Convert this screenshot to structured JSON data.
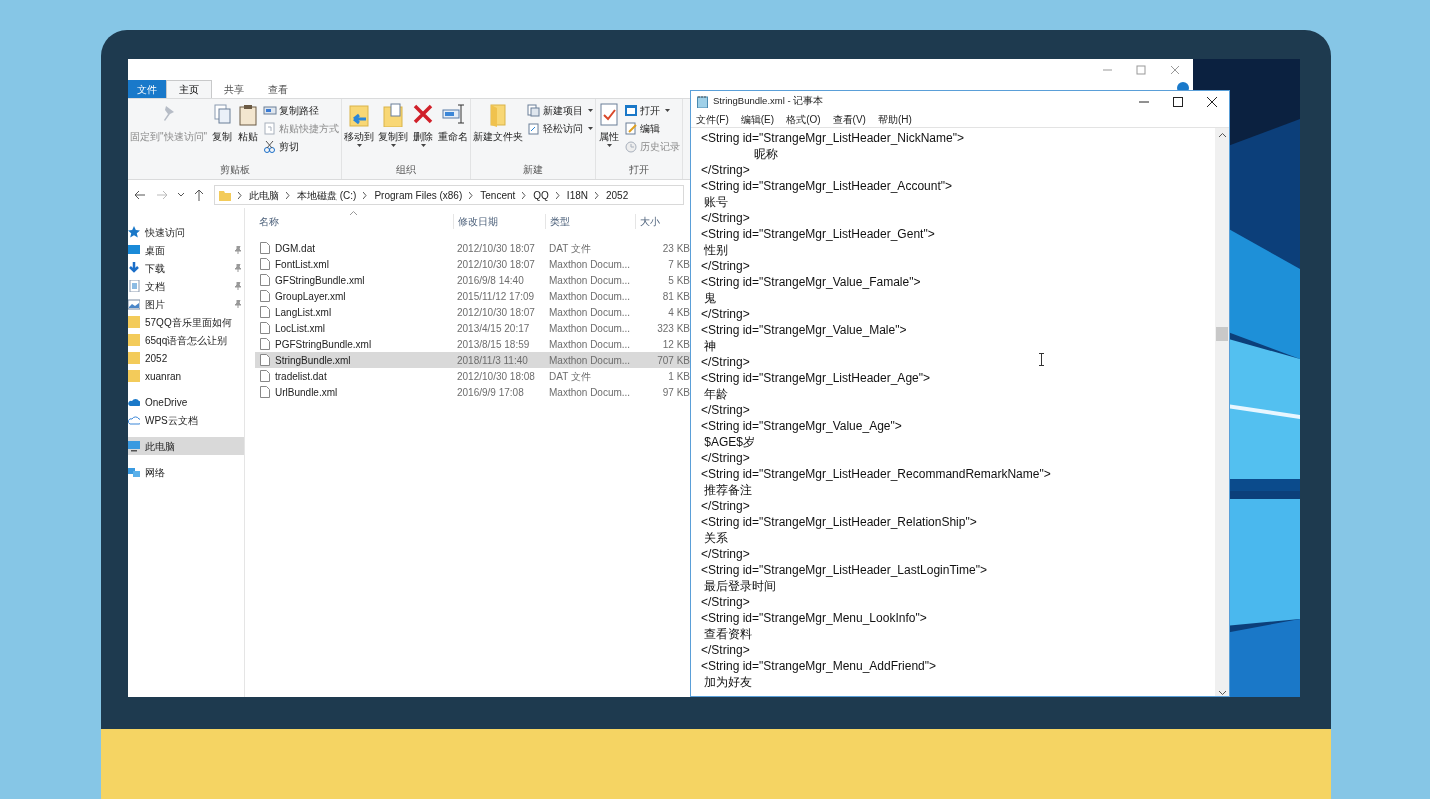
{
  "explorer": {
    "tabs": [
      {
        "label": "文件",
        "selected": false,
        "kind": "file"
      },
      {
        "label": "主页",
        "selected": true,
        "kind": "tab"
      },
      {
        "label": "共享",
        "selected": false,
        "kind": "tab"
      },
      {
        "label": "查看",
        "selected": false,
        "kind": "tab"
      }
    ],
    "ribbon_groups": [
      {
        "label": "剪贴板",
        "items": [
          {
            "kind": "large",
            "label": "固定到\"快速访问\"",
            "disabled": true,
            "dropdown": false
          },
          {
            "kind": "large",
            "label": "复制",
            "disabled": false,
            "dropdown": false
          },
          {
            "kind": "large",
            "label": "粘贴",
            "disabled": false,
            "dropdown": false
          },
          {
            "kind": "small",
            "label": "复制路径",
            "disabled": false,
            "dropdown": false
          },
          {
            "kind": "small",
            "label": "粘贴快捷方式",
            "disabled": true,
            "dropdown": false
          },
          {
            "kind": "small",
            "label": "剪切",
            "disabled": false,
            "dropdown": false
          }
        ]
      },
      {
        "label": "组织",
        "items": [
          {
            "kind": "large",
            "label": "移动到",
            "disabled": false,
            "dropdown": true
          },
          {
            "kind": "large",
            "label": "复制到",
            "disabled": false,
            "dropdown": true
          },
          {
            "kind": "large",
            "label": "删除",
            "disabled": false,
            "dropdown": true
          },
          {
            "kind": "large",
            "label": "重命名",
            "disabled": false,
            "dropdown": false
          }
        ]
      },
      {
        "label": "新建",
        "items": [
          {
            "kind": "large",
            "label": "新建文件夹",
            "disabled": false,
            "dropdown": false
          },
          {
            "kind": "small",
            "label": "新建项目",
            "disabled": false,
            "dropdown": true
          },
          {
            "kind": "small",
            "label": "轻松访问",
            "disabled": false,
            "dropdown": true
          }
        ]
      },
      {
        "label": "打开",
        "items": [
          {
            "kind": "large",
            "label": "属性",
            "disabled": false,
            "dropdown": true
          },
          {
            "kind": "small",
            "label": "打开",
            "disabled": false,
            "dropdown": true
          },
          {
            "kind": "small",
            "label": "编辑",
            "disabled": false,
            "dropdown": false
          },
          {
            "kind": "small",
            "label": "历史记录",
            "disabled": true,
            "dropdown": false
          }
        ]
      }
    ],
    "address": [
      "此电脑",
      "本地磁盘 (C:)",
      "Program Files (x86)",
      "Tencent",
      "QQ",
      "I18N",
      "2052"
    ],
    "nav": [
      {
        "kind": "quick",
        "label": "快速访问",
        "pinned": false,
        "selected": false
      },
      {
        "kind": "desktop",
        "label": "桌面",
        "pinned": true,
        "selected": false
      },
      {
        "kind": "download",
        "label": "下载",
        "pinned": true,
        "selected": false
      },
      {
        "kind": "docs",
        "label": "文档",
        "pinned": true,
        "selected": false
      },
      {
        "kind": "pictures",
        "label": "图片",
        "pinned": true,
        "selected": false
      },
      {
        "kind": "folder",
        "label": "57QQ音乐里面如何",
        "pinned": false,
        "selected": false
      },
      {
        "kind": "folder",
        "label": "65qq语音怎么让别",
        "pinned": false,
        "selected": false
      },
      {
        "kind": "folder",
        "label": "2052",
        "pinned": false,
        "selected": false
      },
      {
        "kind": "folder",
        "label": "xuanran",
        "pinned": false,
        "selected": false
      },
      {
        "kind": "onedrive",
        "label": "OneDrive",
        "pinned": false,
        "selected": false
      },
      {
        "kind": "cloud",
        "label": "WPS云文档",
        "pinned": false,
        "selected": false
      },
      {
        "kind": "pc",
        "label": "此电脑",
        "pinned": false,
        "selected": true
      },
      {
        "kind": "network",
        "label": "网络",
        "pinned": false,
        "selected": false
      }
    ],
    "columns": [
      "名称",
      "修改日期",
      "类型",
      "大小"
    ],
    "rows": [
      {
        "name": "DGM.dat",
        "date": "2012/10/30 18:07",
        "type": "DAT 文件",
        "size": "23 KB",
        "selected": false
      },
      {
        "name": "FontList.xml",
        "date": "2012/10/30 18:07",
        "type": "Maxthon Docum...",
        "size": "7 KB",
        "selected": false
      },
      {
        "name": "GFStringBundle.xml",
        "date": "2016/9/8 14:40",
        "type": "Maxthon Docum...",
        "size": "5 KB",
        "selected": false
      },
      {
        "name": "GroupLayer.xml",
        "date": "2015/11/12 17:09",
        "type": "Maxthon Docum...",
        "size": "81 KB",
        "selected": false
      },
      {
        "name": "LangList.xml",
        "date": "2012/10/30 18:07",
        "type": "Maxthon Docum...",
        "size": "4 KB",
        "selected": false
      },
      {
        "name": "LocList.xml",
        "date": "2013/4/15 20:17",
        "type": "Maxthon Docum...",
        "size": "323 KB",
        "selected": false
      },
      {
        "name": "PGFStringBundle.xml",
        "date": "2013/8/15 18:59",
        "type": "Maxthon Docum...",
        "size": "12 KB",
        "selected": false
      },
      {
        "name": "StringBundle.xml",
        "date": "2018/11/3 11:40",
        "type": "Maxthon Docum...",
        "size": "707 KB",
        "selected": true
      },
      {
        "name": "tradelist.dat",
        "date": "2012/10/30 18:08",
        "type": "DAT 文件",
        "size": "1 KB",
        "selected": false
      },
      {
        "name": "UrlBundle.xml",
        "date": "2016/9/9 17:08",
        "type": "Maxthon Docum...",
        "size": "97 KB",
        "selected": false
      }
    ]
  },
  "notepad": {
    "title": "StringBundle.xml - 记事本",
    "menu": [
      "文件(F)",
      "编辑(E)",
      "格式(O)",
      "查看(V)",
      "帮助(H)"
    ],
    "lines": [
      "<String id=\"StrangeMgr_ListHeader_NickName\">",
      "                昵称",
      "</String>",
      "<String id=\"StrangeMgr_ListHeader_Account\">",
      " 账号",
      "</String>",
      "<String id=\"StrangeMgr_ListHeader_Gent\">",
      " 性别",
      "</String>",
      "<String id=\"StrangeMgr_Value_Famale\">",
      " 鬼",
      "</String>",
      "<String id=\"StrangeMgr_Value_Male\">",
      " 神",
      "</String>",
      "<String id=\"StrangeMgr_ListHeader_Age\">",
      " 年龄",
      "</String>",
      "<String id=\"StrangeMgr_Value_Age\">",
      " $AGE$岁",
      "</String>",
      "<String id=\"StrangeMgr_ListHeader_RecommandRemarkName\">",
      " 推荐备注",
      "</String>",
      "<String id=\"StrangeMgr_ListHeader_RelationShip\">",
      " 关系",
      "</String>",
      "<String id=\"StrangeMgr_ListHeader_LastLoginTime\">",
      " 最后登录时间",
      "</String>",
      "<String id=\"StrangeMgr_Menu_LookInfo\">",
      " 查看资料",
      "</String>",
      "<String id=\"StrangeMgr_Menu_AddFriend\">",
      " 加为好友"
    ]
  }
}
